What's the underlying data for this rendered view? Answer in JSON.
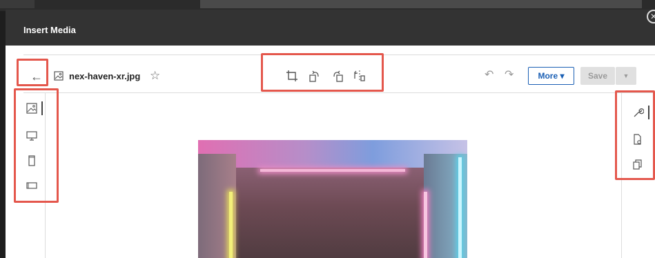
{
  "modal": {
    "title": "Insert Media",
    "close_symbol": "✕"
  },
  "toolbar": {
    "back_symbol": "←",
    "file_name": "nex-haven-xr.jpg",
    "star_symbol": "☆",
    "undo_symbol": "↶",
    "redo_symbol": "↷",
    "more_label": "More ▾",
    "save_label": "Save",
    "save_dropdown_symbol": "▼"
  },
  "icons": {
    "back": "arrow-left-icon",
    "file": "image-icon",
    "star": "star-icon",
    "tools": [
      "crop-icon",
      "rotate-left-icon",
      "rotate-right-icon",
      "flip-icon"
    ],
    "left_rail": [
      "image-icon",
      "desktop-icon",
      "portrait-icon",
      "landscape-icon"
    ],
    "right_rail": [
      "wrench-icon",
      "file-settings-icon",
      "copy-icon"
    ]
  },
  "colors": {
    "accent": "#1a5fb4",
    "annotation": "#e4574c",
    "header_bg": "#333333"
  }
}
